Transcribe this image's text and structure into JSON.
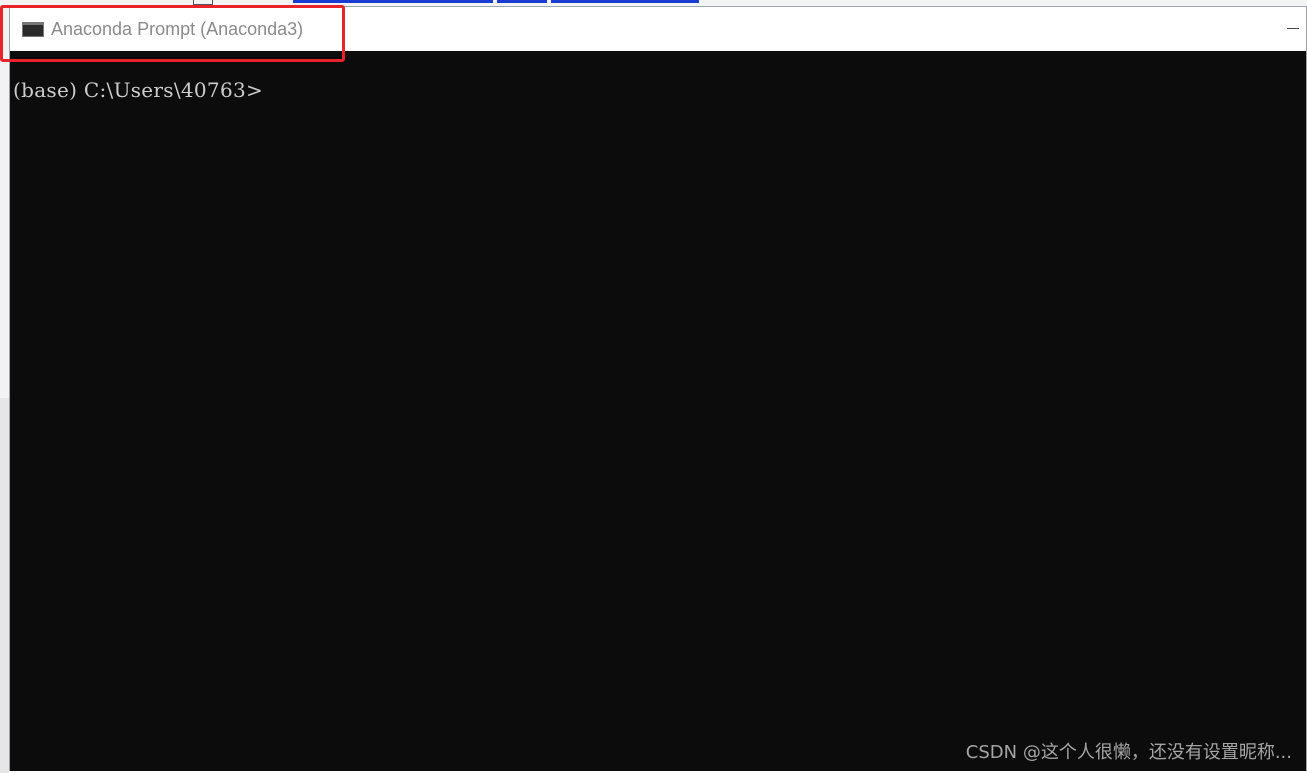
{
  "window": {
    "title": "Anaconda Prompt (Anaconda3)",
    "icon": "terminal-icon"
  },
  "console": {
    "prompt": "(base) C:\\Users\\40763>"
  },
  "watermark": {
    "text": "CSDN @这个人很懒，还没有设置昵称..."
  },
  "colors": {
    "console_bg": "#0c0c0c",
    "console_text": "#cccccc",
    "highlight_border": "#e8232a",
    "title_text": "#8a8a8a"
  }
}
